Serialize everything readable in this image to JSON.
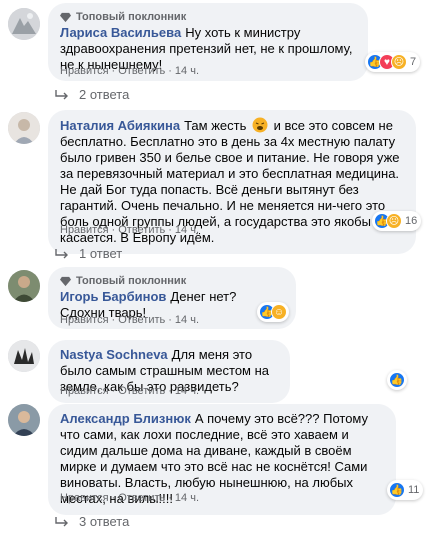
{
  "comments": [
    {
      "badge": "Топовый поклонник",
      "author": "Лариса Васильева",
      "text": "Ну хоть к министру здравоохранения претензий нет, не к прошлому, не к нынешнему!",
      "reaction_count": "7",
      "action_like": "Нравится",
      "action_reply": "Ответить",
      "time": "14 ч.",
      "replies": "2 ответа",
      "reactions": [
        "like-icon",
        "love-icon",
        "sad-icon"
      ]
    },
    {
      "author": "Наталия Абиякина",
      "text_before_emoji": "Там жесть",
      "text_after_emoji": "и все это совсем не бесплатно. Бесплатно это в день за 4х местную палату было гривен 350 и белье свое и питание. Не говоря уже за перевязочный материал и это бесплатная медицина. Не дай Бог туда попасть. Всё деньги вытянут без гарантий. Очень печально. И не меняется ни-чего это боль одной группы людей, а государства это якобы и не касается. В Европу идём.",
      "reaction_count": "16",
      "action_like": "Нравится",
      "action_reply": "Ответить",
      "time": "14 ч.",
      "replies": "1 ответ",
      "reactions": [
        "like-icon",
        "sad-icon"
      ]
    },
    {
      "badge": "Топовый поклонник",
      "author": "Игорь Барбинов",
      "text": "Денег нет? Сдохни тварь!",
      "action_like": "Нравится",
      "action_reply": "Ответить",
      "time": "14 ч.",
      "reactions": [
        "like-icon",
        "haha-icon"
      ]
    },
    {
      "author": "Nastya Sochneva",
      "text": "Для меня это было самым страшным местом на земле, как бы это развидеть?",
      "action_like": "Нравится",
      "action_reply": "Ответить",
      "time": "14 ч.",
      "reactions": [
        "like-icon"
      ]
    },
    {
      "author": "Александр Близнюк",
      "text": "А почему это всё??? Потому что сами, как лохи последние, всё это хаваем и сидим дальше дома на диване, каждый в своём мирке и думаем что это всё нас не коснётся! Сами виноваты. Власть, любую нынешнюю, на любых местах, на вилы!!!!",
      "reaction_count": "11",
      "action_like": "Нравится",
      "action_reply": "Ответить",
      "time": "14 ч.",
      "replies": "3 ответа",
      "reactions": [
        "like-icon"
      ]
    }
  ],
  "separator": "·",
  "colors": {
    "author": "#385898",
    "bubble": "#f0f2f5",
    "meta": "#65676b",
    "like": "#1877f2",
    "love": "#f33e58",
    "emoji": "#f7b125"
  }
}
